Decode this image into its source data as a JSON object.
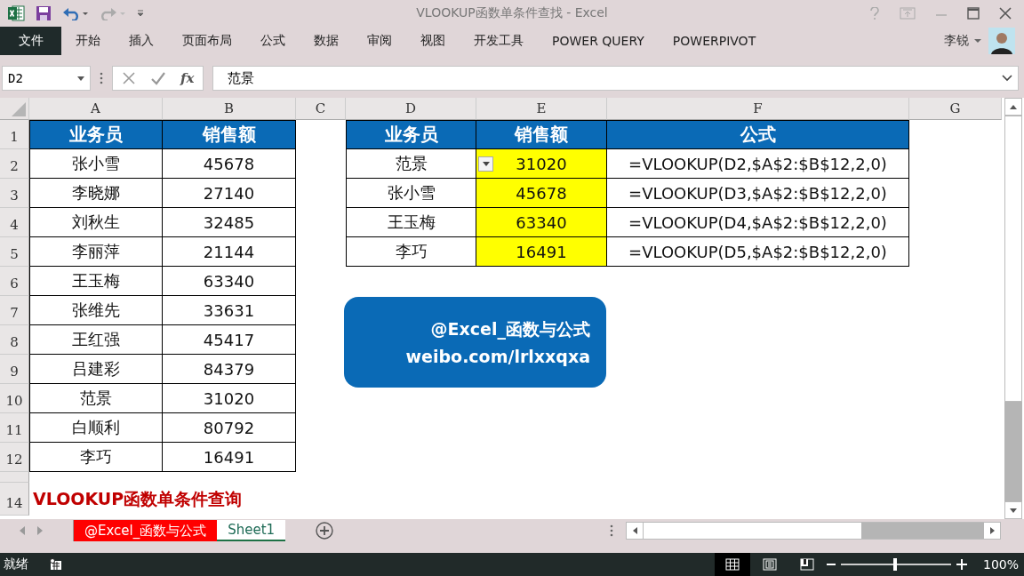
{
  "window": {
    "title": "VLOOKUP函数单条件查找 - Excel",
    "user": "李锐"
  },
  "ribbon_tabs": [
    {
      "label": "文件",
      "selected": true
    },
    {
      "label": "开始",
      "selected": false
    },
    {
      "label": "插入",
      "selected": false
    },
    {
      "label": "页面布局",
      "selected": false
    },
    {
      "label": "公式",
      "selected": false
    },
    {
      "label": "数据",
      "selected": false
    },
    {
      "label": "审阅",
      "selected": false
    },
    {
      "label": "视图",
      "selected": false
    },
    {
      "label": "开发工具",
      "selected": false
    },
    {
      "label": "POWER QUERY",
      "selected": false
    },
    {
      "label": "POWERPIVOT",
      "selected": false
    }
  ],
  "formula_bar": {
    "name_box": "D2",
    "fx": "fx",
    "value": "范景"
  },
  "sheet": {
    "columns": [
      "A",
      "B",
      "C",
      "D",
      "E",
      "F",
      "G"
    ],
    "row_numbers": [
      "1",
      "2",
      "3",
      "4",
      "5",
      "6",
      "7",
      "8",
      "9",
      "10",
      "11",
      "12",
      "14"
    ],
    "left_table": {
      "header": [
        "业务员",
        "销售额"
      ],
      "rows": [
        [
          "张小雪",
          "45678"
        ],
        [
          "李晓娜",
          "27140"
        ],
        [
          "刘秋生",
          "32485"
        ],
        [
          "李丽萍",
          "21144"
        ],
        [
          "王玉梅",
          "63340"
        ],
        [
          "张维先",
          "33631"
        ],
        [
          "王红强",
          "45417"
        ],
        [
          "吕建彩",
          "84379"
        ],
        [
          "范景",
          "31020"
        ],
        [
          "白顺利",
          "80792"
        ],
        [
          "李巧",
          "16491"
        ]
      ]
    },
    "lookup_table": {
      "header": [
        "业务员",
        "销售额",
        "公式"
      ],
      "cell_dropdown": true,
      "rows": [
        {
          "name": "范景",
          "sales": "31020",
          "formula": "=VLOOKUP(D2,$A$2:$B$12,2,0)"
        },
        {
          "name": "张小雪",
          "sales": "45678",
          "formula": "=VLOOKUP(D3,$A$2:$B$12,2,0)"
        },
        {
          "name": "王玉梅",
          "sales": "63340",
          "formula": "=VLOOKUP(D4,$A$2:$B$12,2,0)"
        },
        {
          "name": "李巧",
          "sales": "16491",
          "formula": "=VLOOKUP(D5,$A$2:$B$12,2,0)"
        }
      ]
    },
    "caption": "VLOOKUP函数单条件查询",
    "shape_lines": [
      "@Excel_函数与公式",
      "weibo.com/lrlxxqxa"
    ]
  },
  "sheet_tabs": [
    {
      "label": "@Excel_函数与公式",
      "selected": false,
      "color": "#ff0000"
    },
    {
      "label": "Sheet1",
      "selected": true
    }
  ],
  "status_bar": {
    "status": "就绪",
    "view_buttons": [
      {
        "kind": "normal",
        "selected": true
      },
      {
        "kind": "layout",
        "selected": false
      },
      {
        "kind": "break",
        "selected": false
      }
    ],
    "zoom": {
      "level": 0.49,
      "reading": "100%"
    }
  }
}
